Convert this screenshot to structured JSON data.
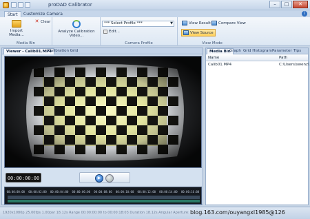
{
  "app": {
    "title": "proDAD Calibrator"
  },
  "ribbon_tabs": [
    "Start",
    "Customize Camera"
  ],
  "ribbon": {
    "media_bin": {
      "import_label": "Import Media...",
      "clear_label": "Clear",
      "group_label": "Media Bin"
    },
    "analyze": {
      "label": "Analyze Calibration Video..."
    },
    "camera_profile": {
      "select_value": "*** Select Profile ***",
      "edit_label": "Edit...",
      "group_label": "Camera Profile"
    },
    "view_mode": {
      "view_result": "View Result",
      "compare_view": "Compare View",
      "view_source": "View Source",
      "group_label": "View Mode"
    }
  },
  "left_pane": {
    "tabs": [
      "Viewer - Calib01.MP4",
      "Calibration Grid"
    ],
    "timecode": "00:00:00:00",
    "timeline_ticks": [
      "00:00:00:00",
      "00:00:02:00",
      "00:00:04:00",
      "00:00:06:00",
      "00:00:08:00",
      "00:00:10:00",
      "00:00:12:00",
      "00:00:14:00",
      "00:00:16:00"
    ]
  },
  "right_pane": {
    "tabs": [
      "Media Bin",
      "Graph",
      "Grid Histogram",
      "Parameter",
      "Tips"
    ],
    "columns": {
      "name": "Name",
      "path": "Path"
    },
    "rows": [
      {
        "name": "Calib01.MP4",
        "path": "C:\\Users\\swenz\\"
      }
    ]
  },
  "status": {
    "text": "1920x1080p   25.00fps   1.00par   18.12s   Range 00:00:00:00 to 00:00:18:03   Duration 18.12s   Angular Aperture: 98..."
  },
  "watermark": "blog.163.com/ouyangxl1985@126"
}
